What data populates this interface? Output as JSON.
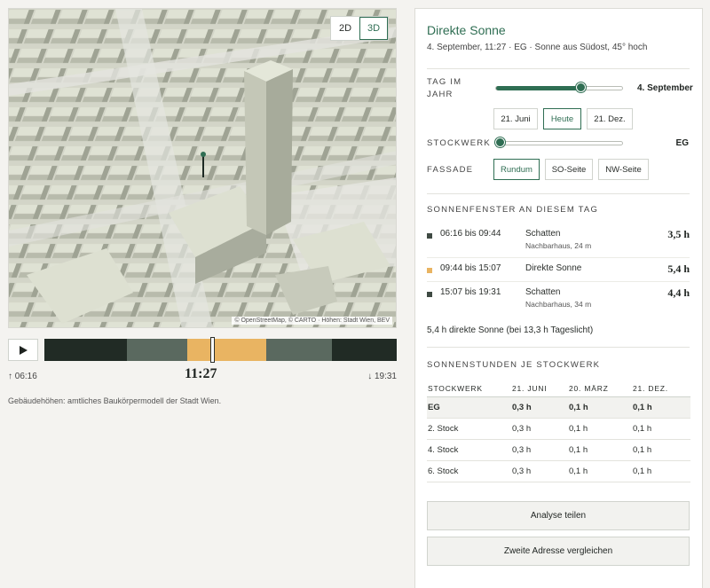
{
  "map": {
    "view_2d": "2D",
    "view_3d": "3D",
    "active_view": "3D",
    "attribution": "© OpenStreetMap, © CARTO · Höhen: Stadt Wien, BEV"
  },
  "timeline": {
    "start": "↑ 06:16",
    "end": "↓ 19:31",
    "current_time": "11:27",
    "segments": [
      {
        "from": 0,
        "to": 0.235,
        "color": "#212b25"
      },
      {
        "from": 0.235,
        "to": 0.405,
        "color": "#5a695f"
      },
      {
        "from": 0.405,
        "to": 0.63,
        "color": "#e9b462"
      },
      {
        "from": 0.63,
        "to": 0.815,
        "color": "#5a695f"
      },
      {
        "from": 0.815,
        "to": 1,
        "color": "#212b25"
      }
    ],
    "handle_fraction": 0.475
  },
  "note": "Gebäudehöhen: amtliches Baukörpermodell der Stadt Wien.",
  "panel": {
    "title": "Direkte Sonne",
    "subtitle": "4. September, 11:27 · EG · Sonne aus Südost, 45° hoch",
    "day_label_1": "TAG IM",
    "day_label_2": "JAHR",
    "day_value": "4. September",
    "day_fraction": 0.66,
    "day_buttons": [
      "21. Juni",
      "Heute",
      "21. Dez."
    ],
    "day_active": "Heute",
    "floor_label": "STOCKWERK",
    "floor_value": "EG",
    "floor_fraction": 0,
    "facade_label": "FASSADE",
    "facade_buttons": [
      "Rundum",
      "SO-Seite",
      "NW-Seite"
    ],
    "facade_active": "Rundum",
    "windows_heading": "SONNENFENSTER AN DIESEM TAG",
    "windows": [
      {
        "range": "06:16 bis 09:44",
        "kind": "Schatten",
        "sub": "Nachbarhaus, 24 m",
        "dur": "3,5 h",
        "color": "#3f4a43"
      },
      {
        "range": "09:44 bis 15:07",
        "kind": "Direkte Sonne",
        "sub": "",
        "dur": "5,4 h",
        "color": "#e9b462"
      },
      {
        "range": "15:07 bis 19:31",
        "kind": "Schatten",
        "sub": "Nachbarhaus, 34 m",
        "dur": "4,4 h",
        "color": "#3f4a43"
      }
    ],
    "summary": "5,4 h direkte Sonne (bei 13,3 h Tageslicht)",
    "floors_heading": "SONNENSTUNDEN JE STOCKWERK",
    "table": {
      "headers": [
        "STOCKWERK",
        "21. JUNI",
        "20. MÄRZ",
        "21. DEZ."
      ],
      "rows": [
        [
          "EG",
          "0,3 h",
          "0,1 h",
          "0,1 h"
        ],
        [
          "2. Stock",
          "0,3 h",
          "0,1 h",
          "0,1 h"
        ],
        [
          "4. Stock",
          "0,3 h",
          "0,1 h",
          "0,1 h"
        ],
        [
          "6. Stock",
          "0,3 h",
          "0,1 h",
          "0,1 h"
        ]
      ]
    },
    "share_button": "Analyse teilen",
    "compare_button": "Zweite Adresse vergleichen"
  }
}
